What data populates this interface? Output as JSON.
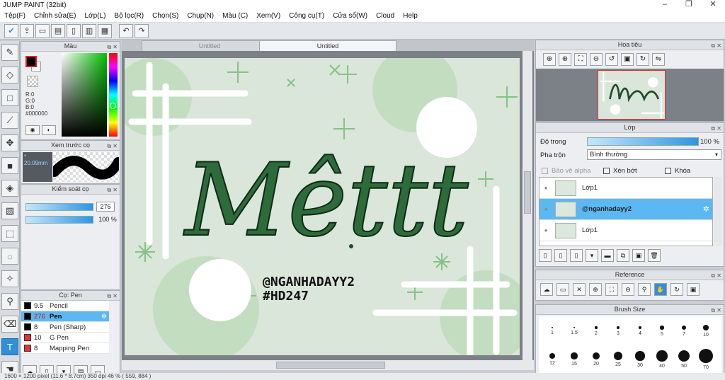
{
  "window": {
    "title": "JUMP PAINT (32bit)",
    "controls": [
      "–",
      "❐",
      "✕"
    ]
  },
  "menu": [
    "Tệp(F)",
    "Chỉnh sửa(E)",
    "Lớp(L)",
    "Bộ lọc(R)",
    "Chọn(S)",
    "Chụp(N)",
    "Màu (C)",
    "Xem(V)",
    "Công cụ(T)",
    "Cửa sổ(W)",
    "Cloud",
    "Help"
  ],
  "tabs": [
    {
      "label": "Untitled",
      "active": false
    },
    {
      "label": "Untitled",
      "active": true
    }
  ],
  "panels": {
    "color": {
      "title": "Màu",
      "r": "R:0",
      "g": "G:0",
      "b": "B:0",
      "hex": "#000000"
    },
    "preview": {
      "title": "Xem trước cọ",
      "size": "20.09mm"
    },
    "control": {
      "title": "Kiểm soát cọ",
      "size_value": "276",
      "opacity_value": "100 %"
    },
    "brush": {
      "title": "Cọ: Pen",
      "items": [
        {
          "size": "9.5",
          "name": "Pencil",
          "color": "#000000",
          "selected": false
        },
        {
          "size": "276",
          "name": "Pen",
          "color": "#000000",
          "selected": true
        },
        {
          "size": "8",
          "name": "Pen (Sharp)",
          "color": "#000000",
          "selected": false
        },
        {
          "size": "10",
          "name": "G Pen",
          "color": "#e83030",
          "selected": false
        },
        {
          "size": "8",
          "name": "Mapping Pen",
          "color": "#e83030",
          "selected": false
        }
      ]
    },
    "navigator": {
      "title": "Hoa tiêu"
    },
    "layer": {
      "title": "Lớp",
      "opacity_label": "Độ trong",
      "opacity_value": "100 %",
      "blend_label": "Pha trộn",
      "blend_value": "Bình thường",
      "protect_alpha": "Bảo vệ alpha",
      "clipping": "Xén bớt",
      "lock": "Khóa",
      "layers": [
        {
          "name": "Lớp1",
          "selected": false
        },
        {
          "name": "@nganhadayy2",
          "selected": true
        },
        {
          "name": "Lớp1",
          "selected": false
        }
      ]
    },
    "reference": {
      "title": "Reference"
    },
    "brush_size": {
      "title": "Brush Size",
      "labels": [
        "1",
        "1.5",
        "2",
        "3",
        "4",
        "5",
        "7",
        "10",
        "12",
        "15",
        "20",
        "25",
        "30",
        "40",
        "50",
        "70"
      ]
    }
  },
  "artwork": {
    "title_text": "Mêttt",
    "handle": "@NGANHADAYY2",
    "hashtag": "#HD247"
  },
  "status": "1600 × 1200 pixel  (11.6 * 8.7cm)  350 dpi  46 %  ( 559, 884 )",
  "colors": {
    "accent": "#2f8fd8",
    "selection": "#5cb8f2",
    "canvas_bg": "#d9e6d9",
    "art_green": "#7fbf7f",
    "ink": "#1f4d2a"
  }
}
